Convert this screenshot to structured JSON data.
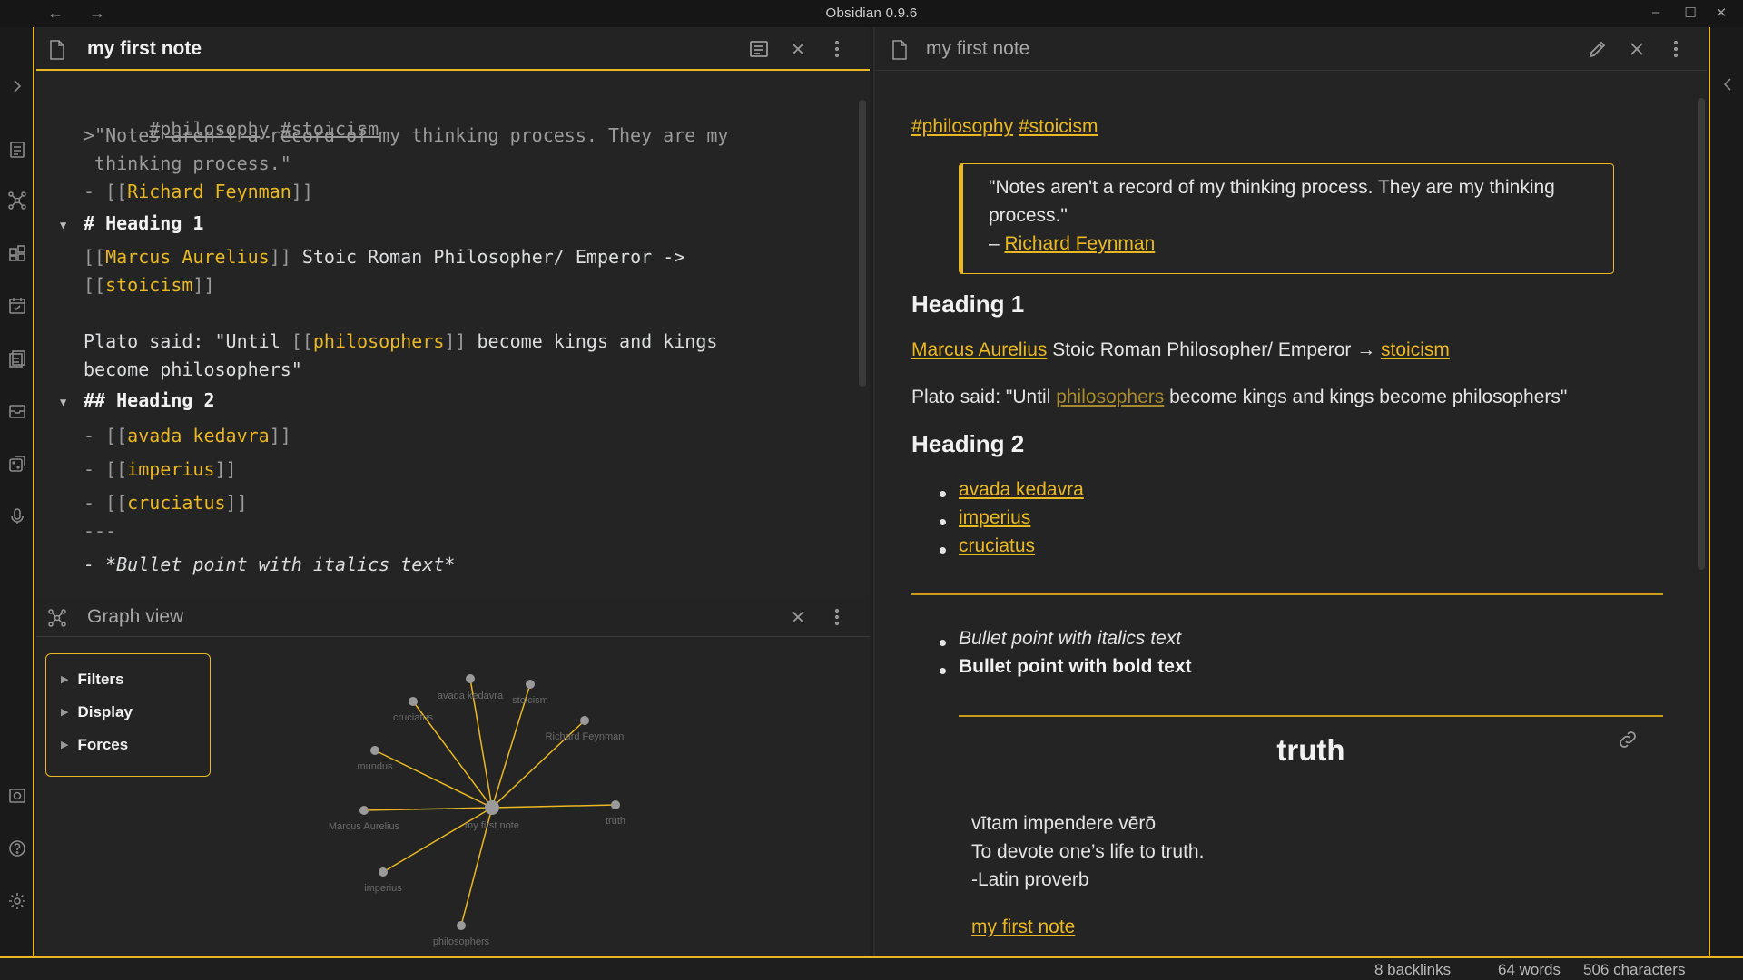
{
  "window": {
    "title": "Obsidian 0.9.6",
    "back_icon": "←",
    "forward_icon": "→",
    "minimize_icon": "–",
    "maximize_icon": "☐",
    "close_icon": "✕"
  },
  "left_pane": {
    "title": "my first note",
    "editor_lines": {
      "tag1": "#philosophy",
      "tag2": "#stoicism",
      "quote1": ">\"Notes aren't a record of my thinking process. They are my",
      "quote2": " thinking process.\"",
      "feynman_prefix": "- [[",
      "feynman_link": "Richard Feynman",
      "feynman_suffix": "]]",
      "heading1": "# Heading 1",
      "marcus_open": "[[",
      "marcus_link": "Marcus Aurelius",
      "marcus_close": "]]",
      "marcus_text": " Stoic Roman Philosopher/ Emperor ->",
      "stoicism_open": "[[",
      "stoicism_link": "stoicism",
      "stoicism_close": "]]",
      "plato_a": "Plato said: \"Until ",
      "plato_open": "[[",
      "plato_link": "philosophers",
      "plato_close": "]]",
      "plato_b": " become kings and kings",
      "plato_c": "become philosophers\"",
      "heading2": "## Heading 2",
      "item_prefix": "- [[",
      "item_suffix": "]]",
      "item1": "avada kedavra",
      "item2": "imperius",
      "item3": "cruciatus",
      "hr": "---",
      "italic_line": "- *Bullet point with italics text*"
    }
  },
  "graph_pane": {
    "title": "Graph view",
    "filters": [
      "Filters",
      "Display",
      "Forces"
    ],
    "nodes": {
      "center": "my first note",
      "n1": "avada kedavra",
      "n2": "stoicism",
      "n3": "cruciatus",
      "n4": "Richard Feynman",
      "n5": "mundus",
      "n6": "Marcus Aurelius",
      "n7": "truth",
      "n8": "imperius",
      "n9": "philosophers"
    }
  },
  "right_pane": {
    "title": "my first note",
    "tag1": "#philosophy",
    "tag2": "#stoicism",
    "quote_line1": "\"Notes aren't a record of my thinking process. They are my thinking",
    "quote_line2": "process.\"",
    "quote_dash": "– ",
    "quote_author": "Richard Feynman",
    "heading1": "Heading 1",
    "marcus_link": "Marcus Aurelius",
    "marcus_text": " Stoic Roman Philosopher/ Emperor → ",
    "stoicism_link": "stoicism",
    "plato_a": "Plato said: \"Until ",
    "plato_link": "philosophers",
    "plato_b": " become kings and kings become philosophers\"",
    "heading2": "Heading 2",
    "list": [
      "avada kedavra",
      "imperius",
      "cruciatus"
    ],
    "italic_item": "Bullet point with italics text",
    "bold_item": "Bullet point with bold text",
    "embed": {
      "title": "truth",
      "line1": "vītam impendere vērō",
      "line2": "To devote one’s life to truth.",
      "line3": "-Latin proverb",
      "backlink": "my first note"
    }
  },
  "status_bar": {
    "backlinks": "8 backlinks",
    "words": "64 words",
    "characters": "506 characters"
  },
  "colors": {
    "accent": "#e9b823",
    "background": "#202020",
    "pane": "#242424"
  }
}
